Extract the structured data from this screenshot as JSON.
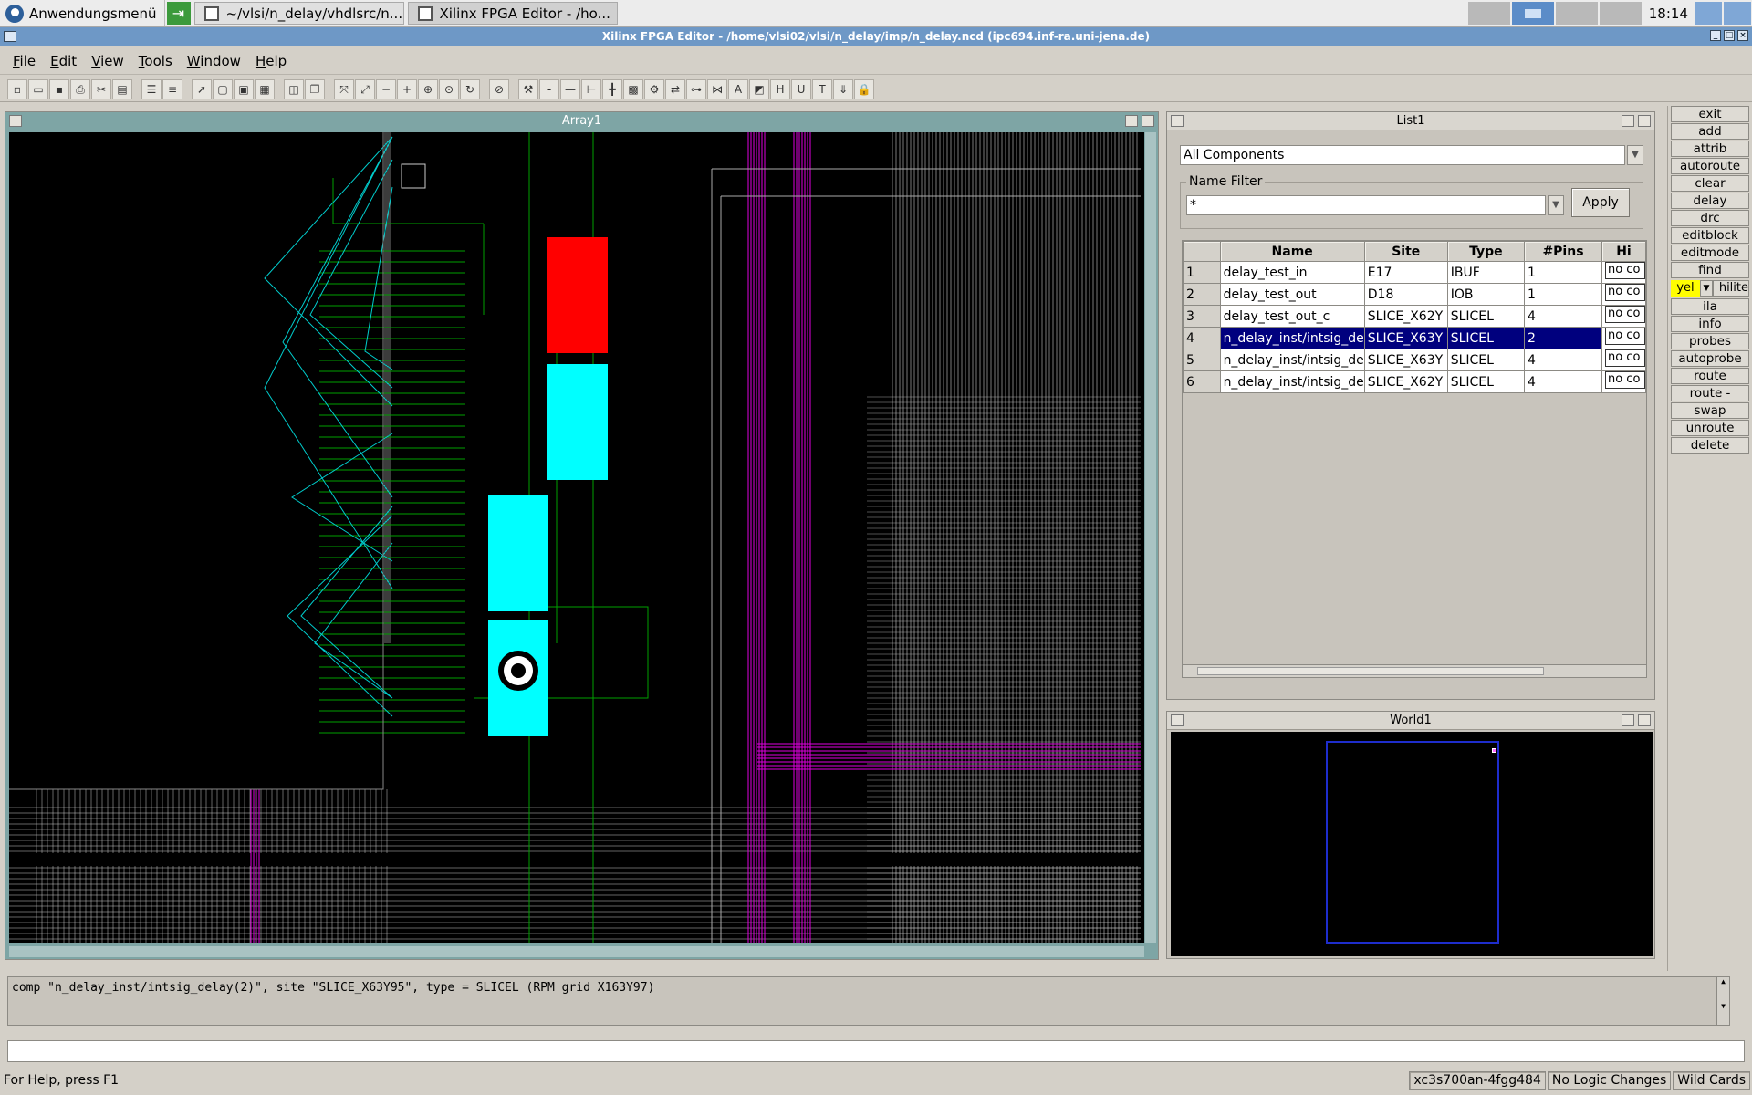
{
  "taskbar": {
    "start_label": "Anwendungsmenü",
    "tasks": [
      "~/vlsi/n_delay/vhdlsrc/n...",
      "Xilinx FPGA Editor - /ho..."
    ],
    "clock": "18:14"
  },
  "window": {
    "title": "Xilinx FPGA Editor - /home/vlsi02/vlsi/n_delay/imp/n_delay.ncd (ipc694.inf-ra.uni-jena.de)"
  },
  "menubar": {
    "items": [
      "File",
      "Edit",
      "View",
      "Tools",
      "Window",
      "Help"
    ]
  },
  "toolbar": {
    "icons": [
      "new-icon",
      "open-icon",
      "save-icon",
      "print-icon",
      "cut-icon",
      "paste-icon",
      "list-icon",
      "list2-icon",
      "arrow-icon",
      "window-icon",
      "window2-icon",
      "table-icon",
      "tile-icon",
      "cascade-icon",
      "zoom-fit-icon",
      "zoom-full-icon",
      "zoom-out-icon",
      "zoom-in-icon",
      "zoom-box-icon",
      "zoom-sel-icon",
      "redraw-icon",
      "stop-icon",
      "tools-icon",
      "minus-icon",
      "wire-icon",
      "pin-icon",
      "route-icon",
      "grid-icon",
      "gear-icon",
      "swap-icon",
      "tree-icon",
      "graph-icon",
      "text-icon",
      "probe-icon",
      "h-icon",
      "u-icon",
      "t-icon",
      "down-icon",
      "lock-icon"
    ]
  },
  "array": {
    "title": "Array1"
  },
  "list": {
    "title": "List1",
    "category_value": "All Components",
    "name_filter_label": "Name Filter",
    "name_filter_value": "*",
    "apply_label": "Apply",
    "columns": [
      "",
      "Name",
      "Site",
      "Type",
      "#Pins",
      "Hi"
    ],
    "rows": [
      {
        "num": "1",
        "name": "delay_test_in",
        "site": "E17",
        "type": "IBUF",
        "pins": "1",
        "hi": "no co"
      },
      {
        "num": "2",
        "name": "delay_test_out",
        "site": "D18",
        "type": "IOB",
        "pins": "1",
        "hi": "no co"
      },
      {
        "num": "3",
        "name": "delay_test_out_c",
        "site": "SLICE_X62Y",
        "type": "SLICEL",
        "pins": "4",
        "hi": "no co"
      },
      {
        "num": "4",
        "name": "n_delay_inst/intsig_de",
        "site": "SLICE_X63Y",
        "type": "SLICEL",
        "pins": "2",
        "hi": "no co"
      },
      {
        "num": "5",
        "name": "n_delay_inst/intsig_de",
        "site": "SLICE_X63Y",
        "type": "SLICEL",
        "pins": "4",
        "hi": "no co"
      },
      {
        "num": "6",
        "name": "n_delay_inst/intsig_de",
        "site": "SLICE_X62Y",
        "type": "SLICEL",
        "pins": "4",
        "hi": "no co"
      }
    ],
    "selected_row": 4
  },
  "world": {
    "title": "World1"
  },
  "commands": {
    "buttons": [
      "exit",
      "add",
      "attrib",
      "autoroute",
      "clear",
      "delay",
      "drc",
      "editblock",
      "editmode",
      "find"
    ],
    "hilite_color": "yel",
    "hilite_label": "hilite",
    "buttons2": [
      "ila",
      "info",
      "probes",
      "autoprobe",
      "route",
      "route -fanout",
      "swap",
      "unroute",
      "delete"
    ]
  },
  "console": {
    "text": "comp \"n_delay_inst/intsig_delay(2)\",  site \"SLICE_X63Y95\",  type = SLICEL  (RPM grid X163Y97)"
  },
  "status": {
    "help": "For Help, press F1",
    "device": "xc3s700an-4fgg484",
    "logic": "No Logic Changes",
    "wildcards": "Wild Cards"
  },
  "colors": {
    "selected_row": "#00007e",
    "slice_red": "#ff0000",
    "slice_cyan": "#00ffff",
    "net_green": "#00a000",
    "net_cyan": "#00cccc",
    "net_magenta": "#e000e0",
    "wire_gray": "#c8c8c8"
  }
}
